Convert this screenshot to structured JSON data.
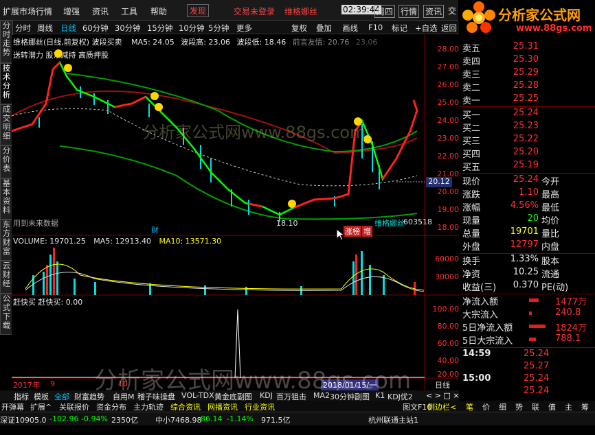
{
  "menu": {
    "items": [
      "扩展市场行情",
      "增强",
      "资讯",
      "工具",
      "帮助",
      "发现"
    ],
    "status": "交易未登录",
    "stock_name": "维格娜丝",
    "time": "02:39:44",
    "weekday": "周四",
    "tabs": [
      "行情",
      "资讯",
      "交"
    ]
  },
  "logo": {
    "text": "分析家公式网",
    "url": "www.88gs.com"
  },
  "toolbar": {
    "periods": [
      "分时",
      "周线",
      "日线",
      "60分钟",
      "30分钟",
      "15分钟",
      "10分钟",
      "5分钟",
      "更多"
    ],
    "active": "日线",
    "actions": [
      "复权",
      "叠加",
      "画线",
      "F10",
      "标记",
      "+自选",
      "返回"
    ]
  },
  "sidetabs": [
    "分时走势",
    "技术分析",
    "成交明细",
    "分价表",
    "基本资料",
    "东方财富",
    "云财经",
    "公式下载"
  ],
  "main_chart": {
    "title": "维格娜丝(日线,前复权) 波段买卖",
    "ma5": "MA5: 24.05",
    "wave_high": "波段高: 23.06",
    "wave_low": "波段低: 18.46",
    "front": "前言友情: 20.76",
    "last": "23.06",
    "subtitle": "送转潜力 股东减持 高质押股",
    "annot_low": "18.10",
    "annot_name": "维格娜丝",
    "annot_code": "603518",
    "note": "用到未来数据",
    "tag1": "财",
    "tag2": "涨榜",
    "tag3": "增",
    "price_level": "20.12",
    "axis": [
      "28.00",
      "27.00",
      "26.00",
      "25.00",
      "24.00",
      "23.00",
      "22.00",
      "21.00",
      "20.00",
      "19.00",
      "18.00"
    ]
  },
  "volume": {
    "label": "VOLUME: 19701.25",
    "ma5": "MA5: 12913.40",
    "ma10": "MA10: 13571.30",
    "axis": [
      "60000",
      "30000"
    ]
  },
  "indicator": {
    "label": "赶快买  赶快买: 0.00",
    "axis": [
      "100.00",
      "80.00",
      "60.00",
      "40.00",
      "20.00"
    ]
  },
  "timeline": {
    "left": "2017年",
    "mid": "9",
    "mid2": "10",
    "right": "2018/01/15/一",
    "period": "日线"
  },
  "bottom_tabs": [
    "指标",
    "模板",
    "全部",
    "财富趋势",
    "自用M",
    "稽子味操盘",
    "VOL-TDX",
    "黄金底副图",
    "KDJ",
    "百万狙击",
    "MA2",
    "30分钟副图",
    "K1",
    "KDJ优2"
  ],
  "bottom_tabs2": [
    "开弹幕",
    "扩展^",
    "关联报价",
    "资金分布",
    "主力轨迹",
    "综合资讯",
    "网播资讯",
    "行业资讯"
  ],
  "quote": {
    "asks": [
      {
        "l": "卖五",
        "v": "25.31"
      },
      {
        "l": "卖四",
        "v": "25.30"
      },
      {
        "l": "卖三",
        "v": "25.29"
      },
      {
        "l": "卖二",
        "v": "25.28"
      },
      {
        "l": "卖一",
        "v": "25.25"
      }
    ],
    "bids": [
      {
        "l": "买一",
        "v": "25.24"
      },
      {
        "l": "买二",
        "v": "25.23"
      },
      {
        "l": "买三",
        "v": "25.22"
      },
      {
        "l": "买四",
        "v": "25.20"
      },
      {
        "l": "买五",
        "v": "25.19"
      }
    ],
    "stats": [
      {
        "l": "现价",
        "v": "25.24",
        "l2": "今开"
      },
      {
        "l": "涨跌",
        "v": "1.10",
        "l2": "最高"
      },
      {
        "l": "涨幅",
        "v": "4.56%",
        "l2": "最低"
      },
      {
        "l": "现量",
        "v": "20",
        "l2": "均价"
      },
      {
        "l": "总量",
        "v": "19701",
        "l2": "量比"
      },
      {
        "l": "外盘",
        "v": "12797",
        "l2": "内盘"
      },
      {
        "l": "换手",
        "v": "1.33%",
        "l2": "股本"
      },
      {
        "l": "净资",
        "v": "10.25",
        "l2": "流通"
      },
      {
        "l": "收益(三)",
        "v": "0.370",
        "l2": "PE(动)"
      }
    ],
    "flows": [
      {
        "l": "净流入额",
        "v": "1477万"
      },
      {
        "l": "大宗流入",
        "v": "240.8"
      },
      {
        "l": "5日净流入额",
        "v": "1824万"
      },
      {
        "l": "5日大宗流入",
        "v": "788.1"
      }
    ],
    "ticks": [
      {
        "t": "14:59",
        "p": "25.24"
      },
      {
        "t": "",
        "p": "25.27"
      },
      {
        "t": "15:00",
        "p": "25.24"
      },
      {
        "t": "",
        "p": "25.24"
      }
    ],
    "side_tabs": [
      "笔",
      "价",
      "细",
      "势",
      "联",
      "值",
      "主",
      "筹"
    ]
  },
  "statusbar": {
    "a": "深证10905.0",
    "b": "-102.96",
    "c": "-0.94%",
    "d": "2350亿",
    "e": "中小7468.98",
    "f": "-86.14",
    "g": "-1.14%",
    "h": "971.5亿",
    "i": "杭州联通主站1",
    "f10": "图文F10",
    "side": "侧边栏<"
  },
  "watermark": {
    "top": "分析家公式网www.88gs.com",
    "bottom": "分析家公式网www.88gs.com"
  }
}
